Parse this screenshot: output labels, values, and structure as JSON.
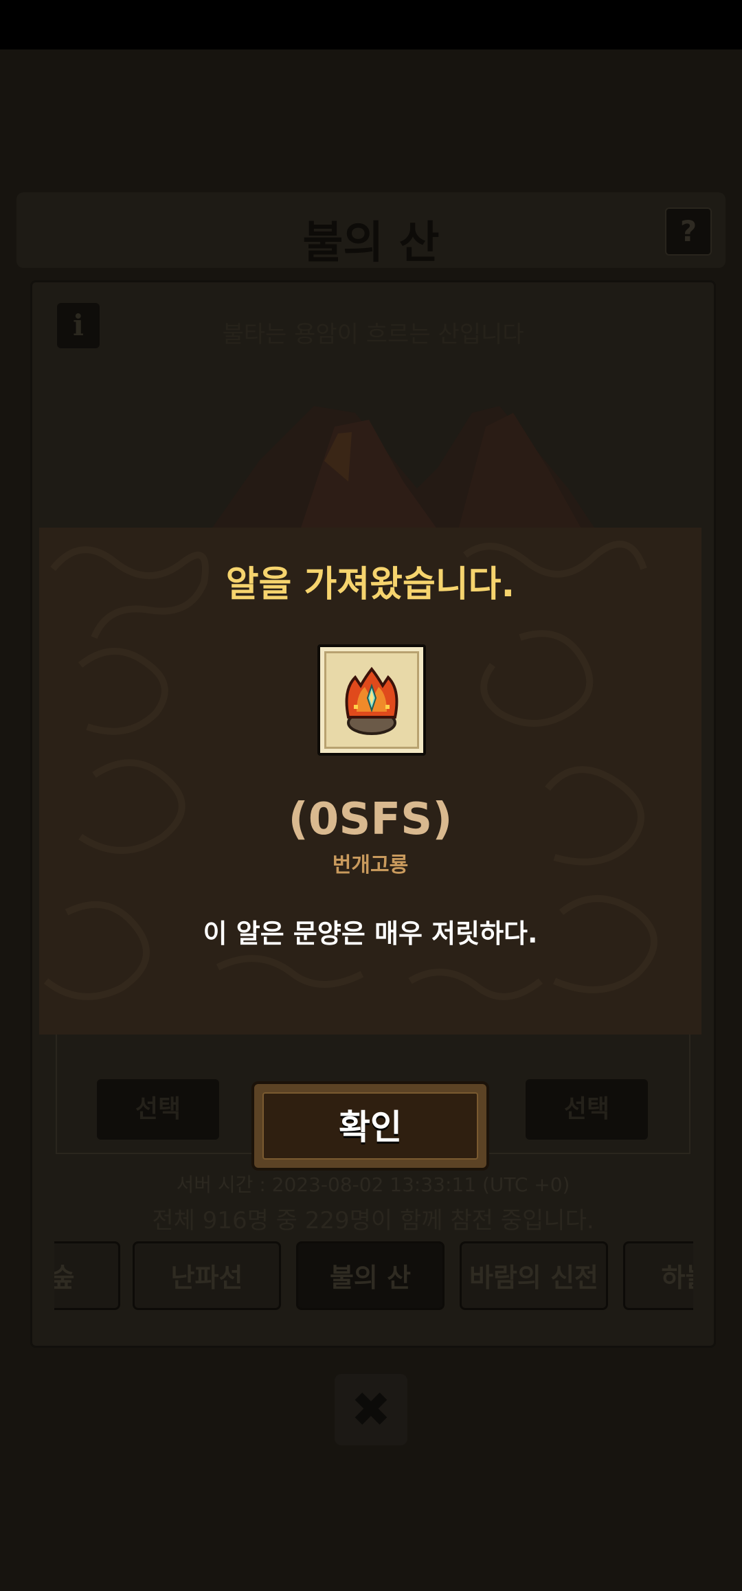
{
  "background": {
    "title": "불의 산",
    "help_label": "?",
    "info_label": "i",
    "description": "불타는 용암이 흐르는 산입니다",
    "select_left": "선택",
    "select_right": "선택",
    "server_time": "서버 시간 : 2023-08-02 13:33:11 (UTC +0)",
    "participants": "전체 916명 중 229명이 함께 참전 중입니다.",
    "tabs": [
      "의 숲",
      "난파선",
      "불의 산",
      "바람의 신전",
      "하늘의"
    ],
    "close_label": "✖"
  },
  "popup": {
    "title": "알을 가져왔습니다.",
    "egg_code": "(0SFS)",
    "egg_name": "번개고룡",
    "egg_description": "이 알은 문양은 매우 저릿하다.",
    "confirm_label": "확인"
  },
  "colors": {
    "popup_bg": "#2b2117",
    "title_yellow": "#f6d46e",
    "egg_name_tan": "#c99a5d"
  }
}
